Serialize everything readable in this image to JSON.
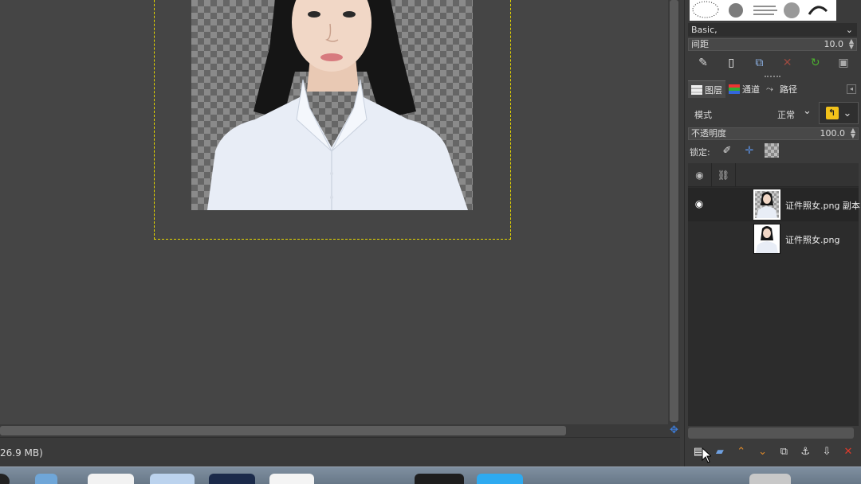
{
  "canvas": {
    "status_text": "26.9 MB)"
  },
  "brushes": {
    "preset_name": "Basic,",
    "spacing_label": "间距",
    "spacing_value": "10.0",
    "actions": [
      "edit-brush-icon",
      "new-brush-icon",
      "duplicate-brush-icon",
      "delete-brush-icon",
      "refresh-brushes-icon",
      "open-as-image-icon"
    ]
  },
  "layers_panel": {
    "tabs": [
      {
        "label": "图层",
        "icon": "layers-icon"
      },
      {
        "label": "通道",
        "icon": "channels-icon"
      },
      {
        "label": "路径",
        "icon": "paths-icon"
      }
    ],
    "mode_label": "模式",
    "mode_value": "正常",
    "opacity_label": "不透明度",
    "opacity_value": "100.0",
    "lock_label": "锁定:",
    "lock_icons": [
      "lock-pixels-icon",
      "lock-position-icon",
      "lock-alpha-icon"
    ],
    "layers": [
      {
        "name": "证件照女.png 副本",
        "visible": true,
        "selected": true
      },
      {
        "name": "证件照女.png",
        "visible": false,
        "selected": false
      }
    ],
    "actions": [
      "new-layer-icon",
      "new-layer-group-icon",
      "raise-layer-icon",
      "lower-layer-icon",
      "duplicate-layer-icon",
      "anchor-layer-icon",
      "merge-down-icon",
      "delete-layer-icon"
    ]
  },
  "colors": {
    "accent_blue": "#3d7bd6",
    "refresh_green": "#4caf2f",
    "delete_red": "#e03a2a",
    "selection_yellow": "#e6d700"
  }
}
